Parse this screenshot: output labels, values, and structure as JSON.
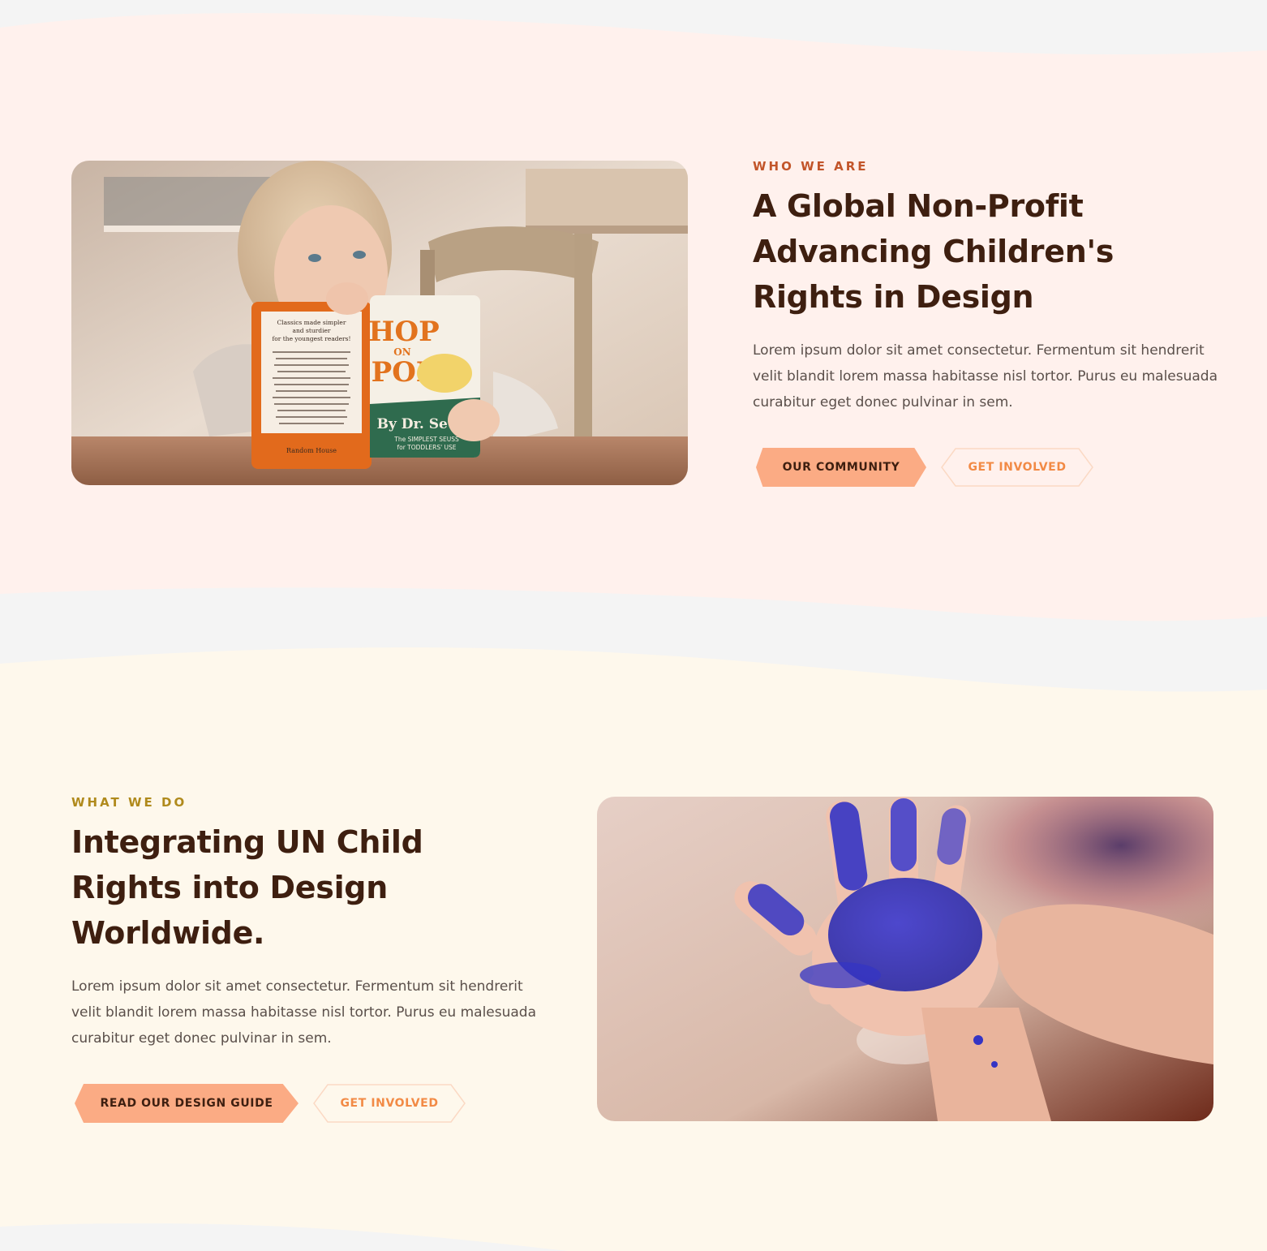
{
  "colors": {
    "section1_bg": "#fff1ed",
    "section2_bg": "#fef8ec",
    "page_bg": "#f4f4f4",
    "eyebrow_1": "#c2552a",
    "eyebrow_2": "#b08a1c",
    "heading": "#3e1f10",
    "body": "#5a4f4a",
    "primary_button": "#fbab84",
    "ghost_button_text": "#f28a45"
  },
  "who_we_are": {
    "eyebrow": "WHO WE ARE",
    "title": "A Global Non-Profit Advancing Children's Rights in Design",
    "body": "Lorem ipsum dolor sit amet consectetur. Fermentum sit hendrerit velit blandit lorem massa habitasse nisl tortor. Purus eu malesuada curabitur eget donec pulvinar in sem.",
    "image_description": "photo-child-reading-book",
    "book": {
      "title_top": "HOP",
      "title_mid": "ON",
      "title_bottom": "POP",
      "author": "By Dr. Seuss",
      "tagline_line1": "The SIMPLEST SEUSS",
      "tagline_line2": "for TODDLERS' USE",
      "left_page_line1": "Classics made simpler",
      "left_page_line2": "and sturdier",
      "left_page_line3": "for the youngest readers!",
      "publisher": "Random House"
    },
    "buttons": {
      "primary": "OUR COMMUNITY",
      "secondary": "GET INVOLVED"
    }
  },
  "what_we_do": {
    "eyebrow": "WHAT WE DO",
    "title": "Integrating UN Child Rights into Design Worldwide.",
    "body": "Lorem ipsum dolor sit amet consectetur. Fermentum sit hendrerit velit blandit lorem massa habitasse nisl tortor. Purus eu malesuada curabitur eget donec pulvinar in sem.",
    "image_description": "photo-painted-hand",
    "buttons": {
      "primary": "READ OUR DESIGN GUIDE",
      "secondary": "GET INVOLVED"
    }
  }
}
